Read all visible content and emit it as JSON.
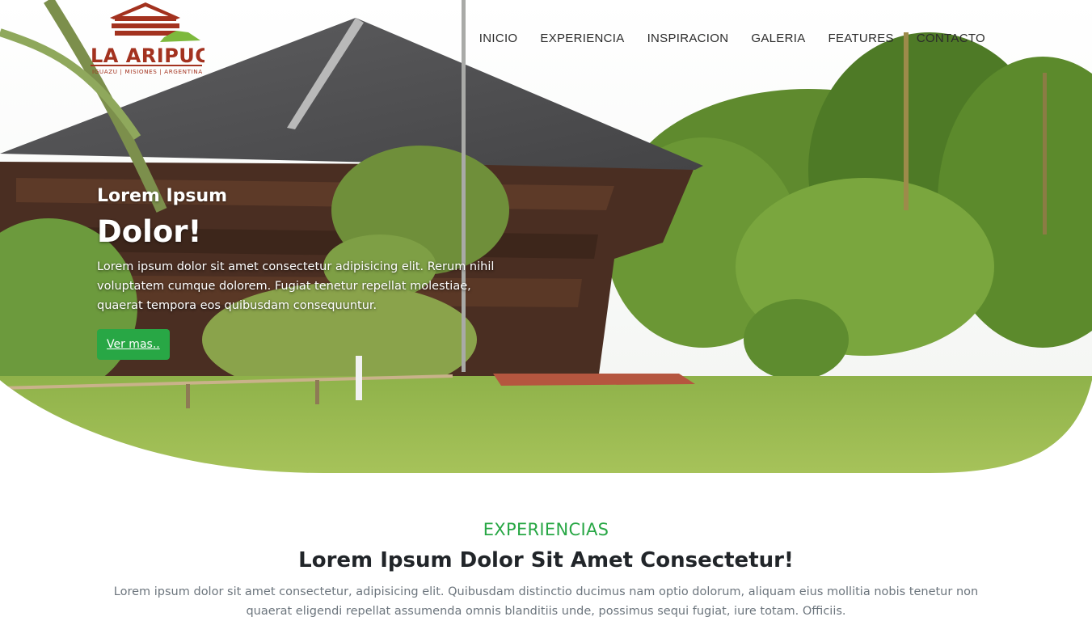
{
  "brand": {
    "name": "LA ARIPUCA",
    "tagline": "IGUAZU | MISIONES | ARGENTINA"
  },
  "nav": {
    "items": [
      "INICIO",
      "EXPERIENCIA",
      "INSPIRACION",
      "GALERIA",
      "FEATURES",
      "CONTACTO"
    ]
  },
  "hero": {
    "subtitle": "Lorem Ipsum",
    "title": "Dolor!",
    "description": "Lorem ipsum dolor sit amet consectetur adipisicing elit. Rerum nihil voluptatem cumque dolorem. Fugiat tenetur repellat molestiae, quaerat tempora eos quibusdam consequuntur.",
    "button_label": "Ver mas.."
  },
  "experiencias": {
    "kicker": "EXPERIENCIAS",
    "title": "Lorem Ipsum Dolor Sit Amet Consectetur!",
    "description": "Lorem ipsum dolor sit amet consectetur, adipisicing elit. Quibusdam distinctio ducimus nam optio dolorum, aliquam eius mollitia nobis tenetur non quaerat eligendi repellat assumenda omnis blanditiis unde, possimus sequi fugiat, iure totam. Officiis."
  },
  "colors": {
    "accent": "#28a745",
    "logo_red": "#a3321f",
    "logo_green": "#7db93c"
  }
}
